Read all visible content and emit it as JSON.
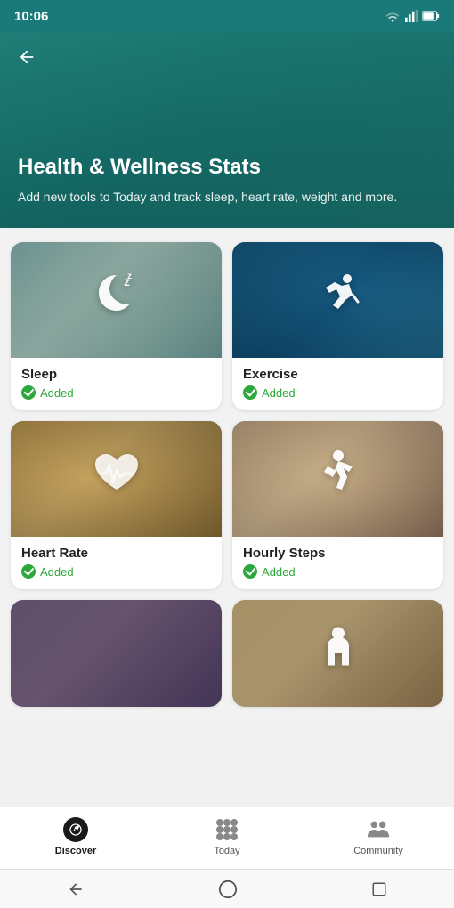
{
  "statusBar": {
    "time": "10:06"
  },
  "header": {
    "title": "Health & Wellness Stats",
    "subtitle": "Add new tools to Today and track sleep, heart rate, weight and more."
  },
  "cards": [
    {
      "id": "sleep",
      "title": "Sleep",
      "status": "Added",
      "imageType": "sleep"
    },
    {
      "id": "exercise",
      "title": "Exercise",
      "status": "Added",
      "imageType": "exercise"
    },
    {
      "id": "heartrate",
      "title": "Heart Rate",
      "status": "Added",
      "imageType": "heartrate"
    },
    {
      "id": "hourlysteps",
      "title": "Hourly Steps",
      "status": "Added",
      "imageType": "steps"
    }
  ],
  "partialCards": [
    {
      "id": "partial1",
      "imageType": "partial1"
    },
    {
      "id": "partial2",
      "imageType": "partial2"
    }
  ],
  "bottomNav": {
    "items": [
      {
        "id": "discover",
        "label": "Discover",
        "active": true
      },
      {
        "id": "today",
        "label": "Today",
        "active": false
      },
      {
        "id": "community",
        "label": "Community",
        "active": false
      }
    ]
  }
}
